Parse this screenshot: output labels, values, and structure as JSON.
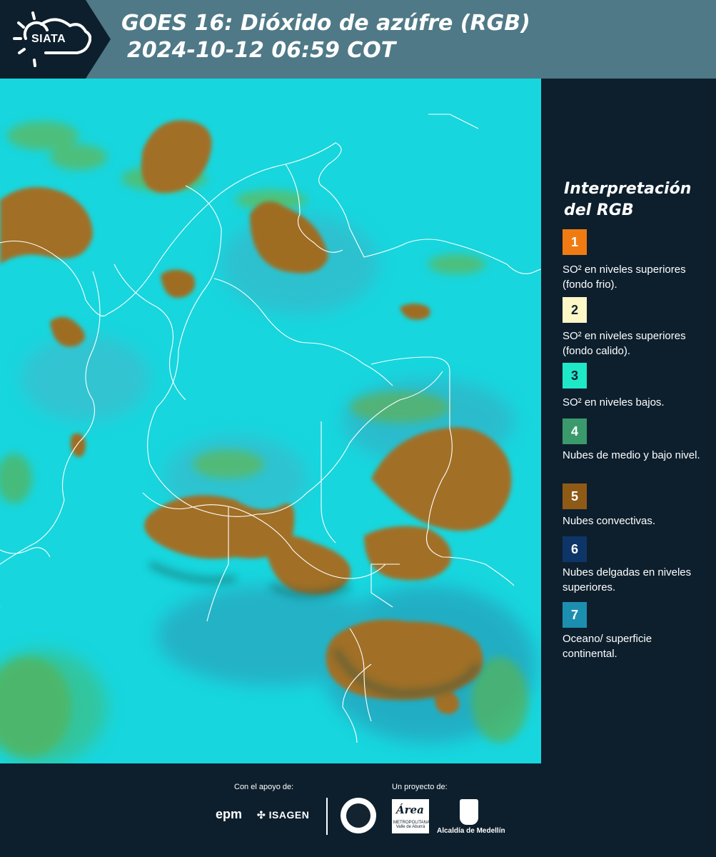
{
  "header": {
    "logo": "SIATA",
    "title_line1": "GOES 16: Dióxido de azúfre (RGB)",
    "title_line2": "2024-10-12 06:59 COT"
  },
  "map": {
    "background_color": "#17d6de",
    "cloud_color": "#9a6b22",
    "low_cloud_color": "#4fae5e",
    "border_color": "#ffffff"
  },
  "legend": {
    "title_line1": "Interpretación",
    "title_line2": "del RGB",
    "items": [
      {
        "number": "1",
        "color": "#f07b12",
        "text_color": "#ffffff",
        "label": "SO² en niveles superiores (fondo frio)."
      },
      {
        "number": "2",
        "color": "#fdf7c8",
        "text_color": "#0d1f2d",
        "label": "SO² en niveles superiores (fondo calido)."
      },
      {
        "number": "3",
        "color": "#1ee8c8",
        "text_color": "#0d1f2d",
        "label": "SO² en niveles bajos."
      },
      {
        "number": "4",
        "color": "#3a9a6c",
        "text_color": "#ffffff",
        "label": "Nubes de medio y bajo nivel."
      },
      {
        "number": "5",
        "color": "#8e5a16",
        "text_color": "#ffffff",
        "label": "Nubes convectivas."
      },
      {
        "number": "6",
        "color": "#0e3568",
        "text_color": "#ffffff",
        "label": "Nubes delgadas en niveles superiores."
      },
      {
        "number": "7",
        "color": "#1c8fb0",
        "text_color": "#ffffff",
        "label": "Oceano/ superficie continental."
      }
    ]
  },
  "footer": {
    "support_label": "Con el apoyo de:",
    "project_label": "Un proyecto de:",
    "sponsor_1": "epm",
    "sponsor_2": "ISAGEN",
    "partner_1": "Área",
    "partner_1_sub": "METROPOLITANA Valle de Aburrá",
    "partner_2": "Alcaldía de Medellín"
  }
}
